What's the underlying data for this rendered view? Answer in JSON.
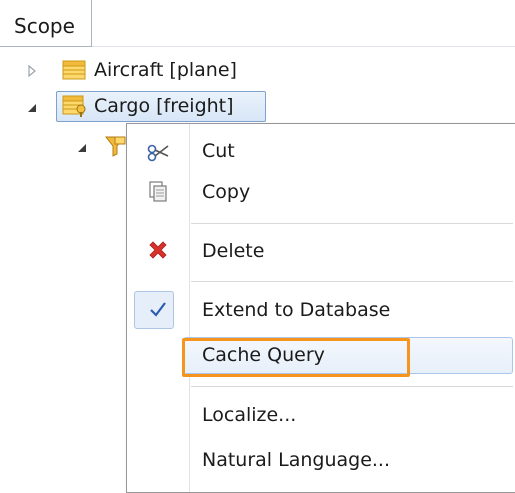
{
  "panel": {
    "tab_title": "Scope"
  },
  "tree": {
    "nodes": [
      {
        "label": "Aircraft [plane]",
        "expanded": false,
        "icon": "table-icon"
      },
      {
        "label": "Cargo [freight]",
        "expanded": true,
        "selected": true,
        "icon": "table-key-icon"
      },
      {
        "label": "",
        "expanded": true,
        "icon": "query-filter-icon"
      }
    ]
  },
  "context_menu": {
    "items": [
      {
        "label": "Cut",
        "icon": "scissors-icon"
      },
      {
        "label": "Copy",
        "icon": "copy-icon"
      },
      {
        "label": "Delete",
        "icon": "delete-icon"
      },
      {
        "label": "Extend to Database",
        "icon": "checkmark-icon",
        "checked": true
      },
      {
        "label": "Cache Query",
        "icon": "",
        "highlighted": true
      },
      {
        "label": "Localize...",
        "icon": ""
      },
      {
        "label": "Natural Language...",
        "icon": ""
      }
    ]
  },
  "colors": {
    "highlight_border": "#f7941d",
    "selection_border": "#7da2ce",
    "delete_red": "#d9302c",
    "check_blue": "#2a5db0"
  }
}
